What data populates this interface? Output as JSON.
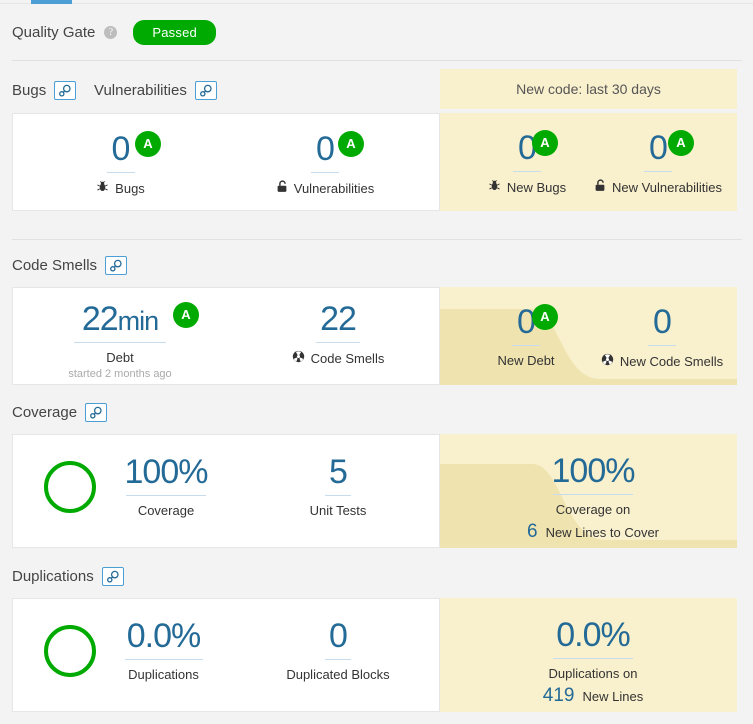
{
  "app": {
    "quality_gate_label": "Quality Gate",
    "quality_gate_status": "Passed",
    "help_icon": "help-icon",
    "accent_blue": "#4b9fd5",
    "status_green": "#00aa00",
    "new_code_bg": "#f9f0cd",
    "value_blue": "#236a97"
  },
  "new_code": {
    "header": "New code: last 30 days"
  },
  "sections": {
    "bugs_vulns": {
      "title_left": "Bugs",
      "title_right": "Vulnerabilities",
      "left_measures": [
        {
          "value": "0",
          "label": "Bugs",
          "icon": "bug-icon",
          "rating": "A"
        },
        {
          "value": "0",
          "label": "Vulnerabilities",
          "icon": "lock-open-icon",
          "rating": "A"
        }
      ],
      "new_measures": [
        {
          "value": "0",
          "label": "New Bugs",
          "icon": "bug-icon",
          "rating": "A"
        },
        {
          "value": "0",
          "label": "New Vulnerabilities",
          "icon": "lock-open-icon",
          "rating": "A"
        }
      ]
    },
    "code_smells": {
      "title": "Code Smells",
      "left_measures": [
        {
          "value": "22",
          "unit": "min",
          "label": "Debt",
          "sublabel": "started 2 months ago",
          "rating": "A"
        },
        {
          "value": "22",
          "label": "Code Smells",
          "icon": "code-smell-icon"
        }
      ],
      "new_measures": [
        {
          "value": "0",
          "label": "New Debt",
          "rating": "A"
        },
        {
          "value": "0",
          "label": "New Code Smells",
          "icon": "code-smell-icon"
        }
      ]
    },
    "coverage": {
      "title": "Coverage",
      "left_measures": [
        {
          "value": "100%",
          "label": "Coverage",
          "ring": true
        },
        {
          "value": "5",
          "label": "Unit Tests"
        }
      ],
      "new_measures": [
        {
          "value": "100%",
          "label_line1": "Coverage on",
          "label_inline_num": "6",
          "label_line2": "New Lines to Cover"
        }
      ]
    },
    "duplications": {
      "title": "Duplications",
      "left_measures": [
        {
          "value": "0.0%",
          "label": "Duplications",
          "ring": true
        },
        {
          "value": "0",
          "label": "Duplicated Blocks"
        }
      ],
      "new_measures": [
        {
          "value": "0.0%",
          "label_line1": "Duplications on",
          "label_inline_num": "419",
          "label_line2": "New Lines"
        }
      ]
    }
  }
}
